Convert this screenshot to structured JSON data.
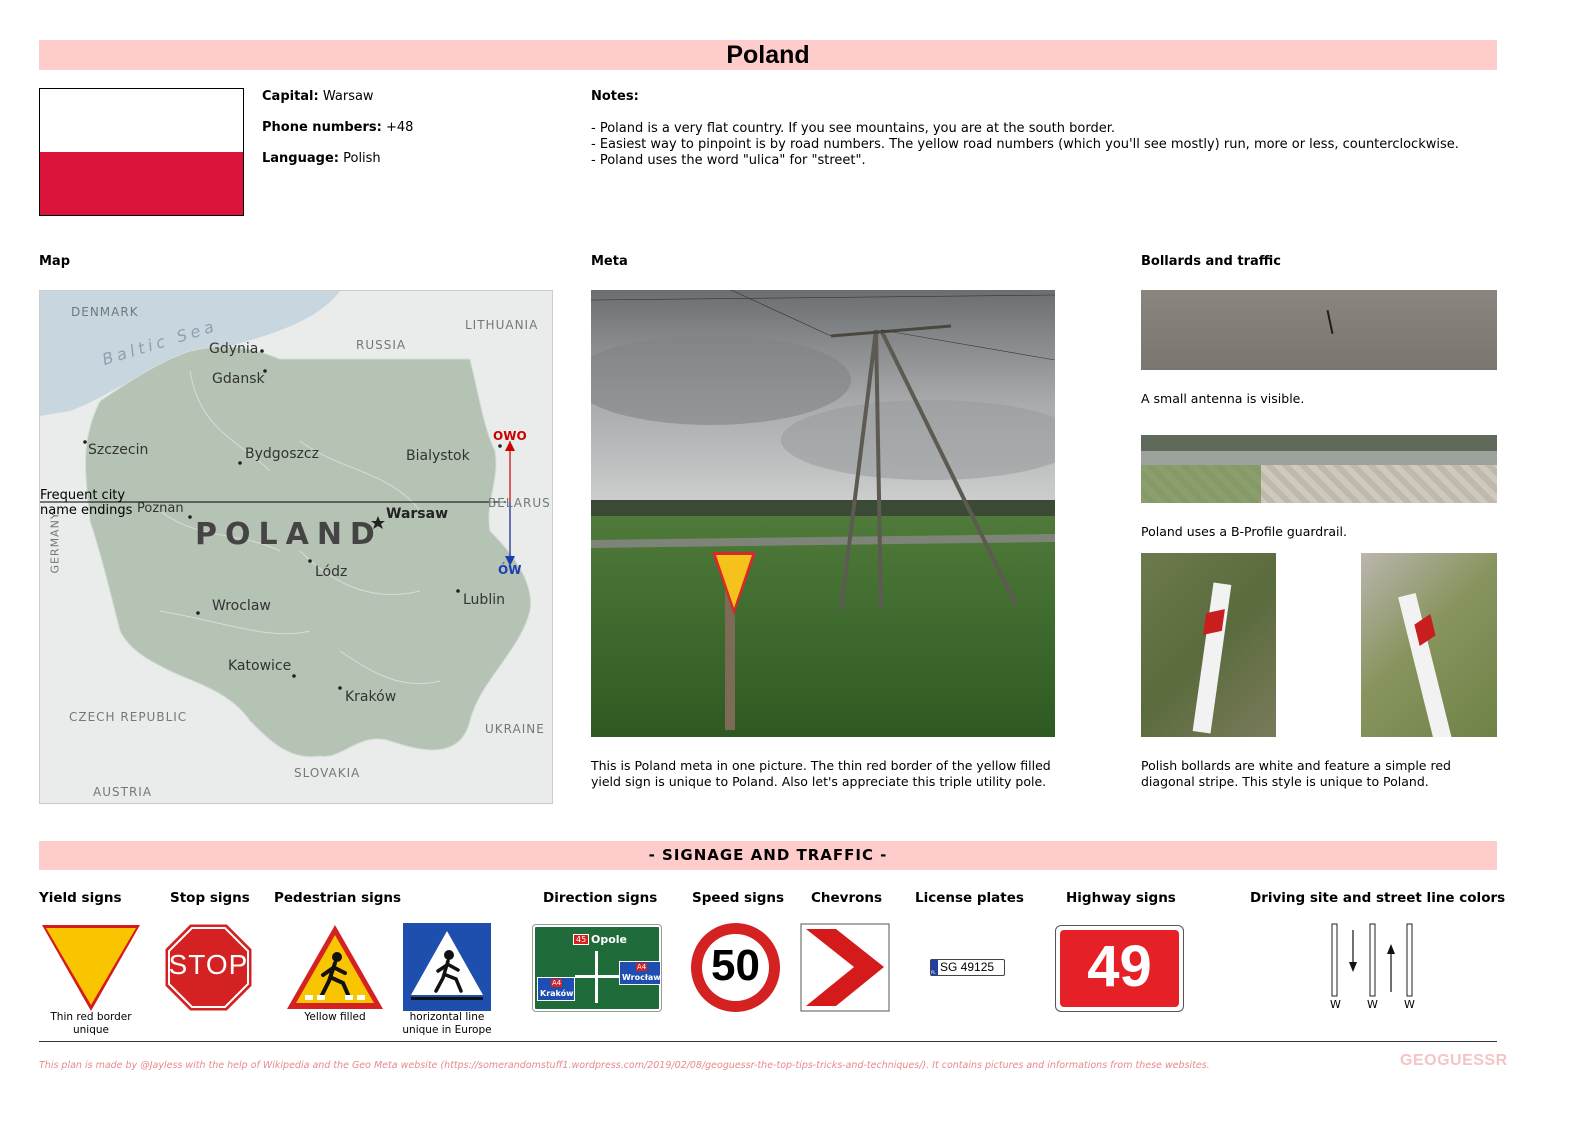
{
  "page": {
    "title": "Poland"
  },
  "info": {
    "capital_label": "Capital:",
    "capital": "Warsaw",
    "phone_label": "Phone numbers:",
    "phone": "+48",
    "language_label": "Language:",
    "language": "Polish"
  },
  "notes": {
    "heading": "Notes:",
    "lines": [
      "- Poland is a very flat country. If you see mountains, you are at the south border.",
      "- Easiest way to pinpoint is by road numbers. The yellow road numbers (which you'll see mostly) run, more or less, counterclockwise.",
      "- Poland uses the word \"ulica\" for \"street\"."
    ]
  },
  "sections": {
    "map": "Map",
    "meta": "Meta",
    "bollards": "Bollards and traffic"
  },
  "map": {
    "countries": [
      "DENMARK",
      "LITHUANIA",
      "RUSSIA",
      "BELARUS",
      "GERMANY",
      "CZECH REPUBLIC",
      "UKRAINE",
      "SLOVAKIA",
      "AUSTRIA"
    ],
    "sea": "Baltic Sea",
    "country": "POLAND",
    "cities": [
      "Gdynia",
      "Gdansk",
      "Szczecin",
      "Bydgoszcz",
      "Bialystok",
      "Poznan",
      "Warsaw",
      "Lódz",
      "Lublin",
      "Wroclaw",
      "Katowice",
      "Kraków"
    ],
    "endings_note": "Frequent city name endings",
    "ending_north": "OWO",
    "ending_south": "ÓW",
    "north_color": "#cc0000",
    "south_color": "#1a3fb0"
  },
  "meta_caption": "This is Poland meta in one picture. The thin red border of the yellow filled yield sign is unique to Poland. Also let's appreciate this triple utility pole.",
  "bollards": {
    "antenna_caption": "A small antenna is visible.",
    "guardrail_caption": "Poland uses a B-Profile guardrail.",
    "bollard_caption": "Polish bollards are white and feature a simple red diagonal stripe. This style is unique to Poland."
  },
  "signage": {
    "banner": "- SIGNAGE AND TRAFFIC -",
    "headers": {
      "yield": "Yield signs",
      "stop": "Stop signs",
      "pedestrian": "Pedestrian signs",
      "direction": "Direction signs",
      "speed": "Speed signs",
      "chevrons": "Chevrons",
      "plates": "License plates",
      "highway": "Highway signs",
      "driving": "Driving site and street line colors"
    },
    "yield_note": "Thin red border unique",
    "stop_text": "STOP",
    "ped_note_1": "Yellow filled",
    "ped_note_2": "horizontal line unique in Europe",
    "direction": {
      "road_num": "45",
      "city_top": "Opole",
      "route_a4": "A4",
      "city_left": "Kraków",
      "city_right": "Wrocław"
    },
    "speed": "50",
    "plate": "SG 49125",
    "plate_country": "PL",
    "highway": "49",
    "lane_w": [
      "W",
      "W",
      "W"
    ]
  },
  "footer": {
    "text": "This plan is made by @Jayless with the help of Wikipedia and the Geo Meta website (https://somerandomstuff1.wordpress.com/2019/02/08/geoguessr-the-top-tips-tricks-and-techniques/). It contains pictures and informations from these websites.",
    "logo": "GEOGUESSR"
  },
  "colors": {
    "banner": "#ffcccc",
    "flag_red": "#dc143c",
    "footer_text": "#e88a8a",
    "sign_red": "#cc0000",
    "sign_yellow": "#f9c400"
  }
}
